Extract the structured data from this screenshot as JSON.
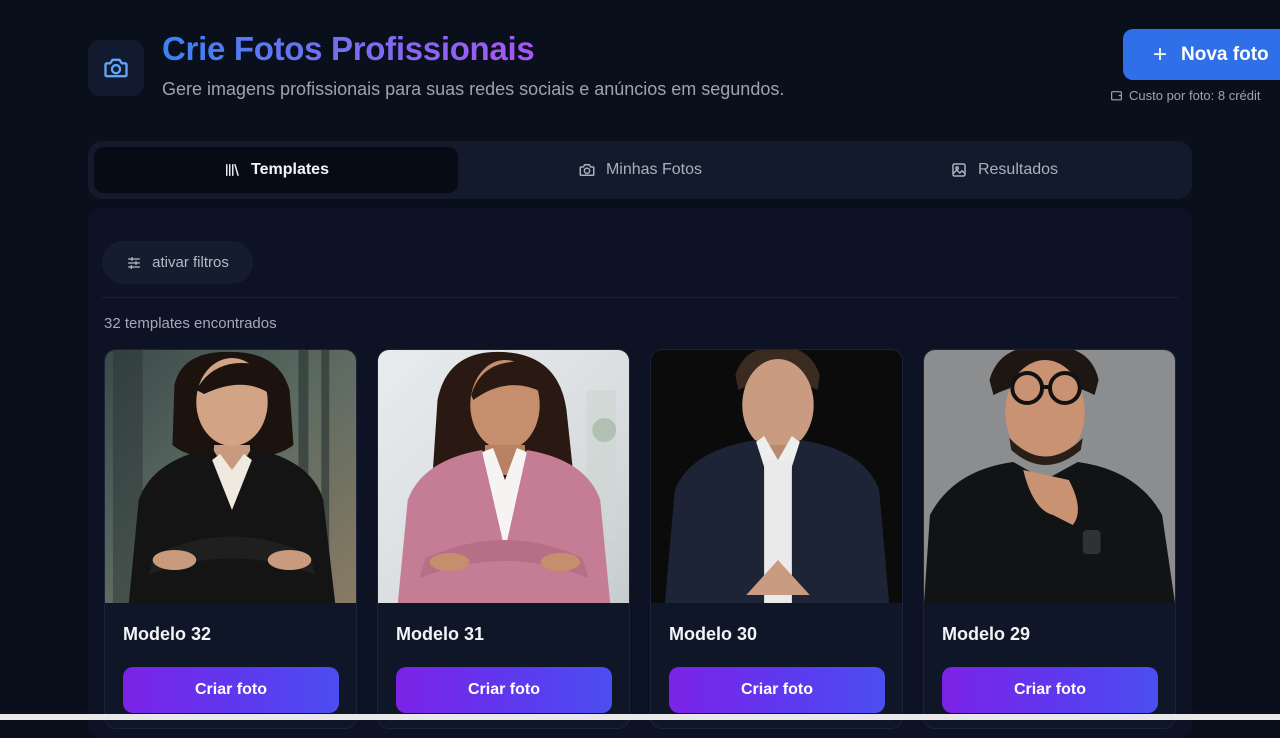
{
  "header": {
    "title": "Crie Fotos Profissionais",
    "subtitle": "Gere imagens profissionais para suas redes sociais e anúncios em segundos.",
    "new_button": "Nova foto",
    "cost_text": "Custo por foto: 8 crédit"
  },
  "tabs": [
    {
      "label": "Templates",
      "icon": "library-icon",
      "active": true
    },
    {
      "label": "Minhas Fotos",
      "icon": "camera-icon",
      "active": false
    },
    {
      "label": "Resultados",
      "icon": "gallery-icon",
      "active": false
    }
  ],
  "filters": {
    "label": "ativar filtros",
    "icon": "sliders-icon"
  },
  "results": {
    "count_text": "32 templates encontrados"
  },
  "cards": [
    {
      "name": "Modelo 32",
      "button": "Criar foto"
    },
    {
      "name": "Modelo 31",
      "button": "Criar foto"
    },
    {
      "name": "Modelo 30",
      "button": "Criar foto"
    },
    {
      "name": "Modelo 29",
      "button": "Criar foto"
    }
  ],
  "colors": {
    "background": "#0a0f1c",
    "primary_button": "#2f6fe8",
    "card_button_gradient_start": "#7c22e6",
    "card_button_gradient_end": "#4c4ef0"
  }
}
